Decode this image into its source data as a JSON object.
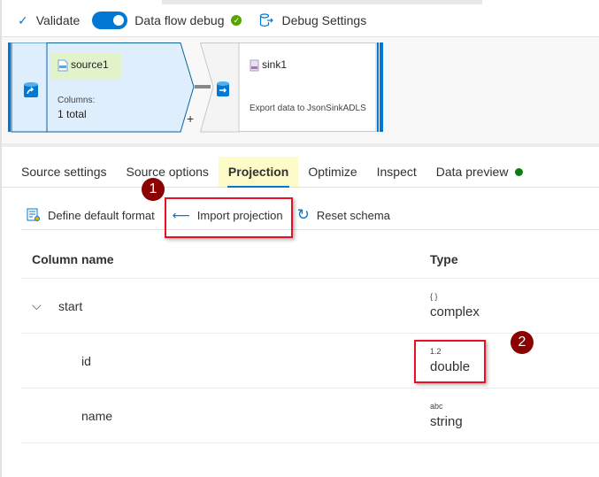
{
  "toolbar": {
    "validate_label": "Validate",
    "debug_toggle_label": "Data flow debug",
    "debug_toggle_on": true,
    "debug_settings_label": "Debug Settings"
  },
  "canvas": {
    "source": {
      "name": "source1",
      "columns_label": "Columns:",
      "columns_value": "1 total"
    },
    "sink": {
      "name": "sink1",
      "description": "Export data to JsonSinkADLS"
    },
    "add_label": "+"
  },
  "tabs": [
    {
      "label": "Source settings",
      "active": false
    },
    {
      "label": "Source options",
      "active": false
    },
    {
      "label": "Projection",
      "active": true
    },
    {
      "label": "Optimize",
      "active": false
    },
    {
      "label": "Inspect",
      "active": false
    },
    {
      "label": "Data preview",
      "active": false,
      "status": "green-dot"
    }
  ],
  "actions": {
    "define_format": "Define default format",
    "import_projection": "Import projection",
    "reset_schema": "Reset schema"
  },
  "table": {
    "headers": {
      "column": "Column name",
      "type": "Type"
    },
    "rows": [
      {
        "name": "start",
        "type_glyph": "{ }",
        "type": "complex",
        "expandable": true
      },
      {
        "name": "id",
        "type_glyph": "1.2",
        "type": "double",
        "expandable": false
      },
      {
        "name": "name",
        "type_glyph": "abc",
        "type": "string",
        "expandable": false
      }
    ]
  },
  "annotations": {
    "badge1": "1",
    "badge2": "2"
  },
  "colors": {
    "accent": "#0078d4",
    "highlight": "#e81123",
    "badge": "#8b0000",
    "tab_highlight": "#fdfcc8",
    "source_fill": "#deeefc"
  }
}
